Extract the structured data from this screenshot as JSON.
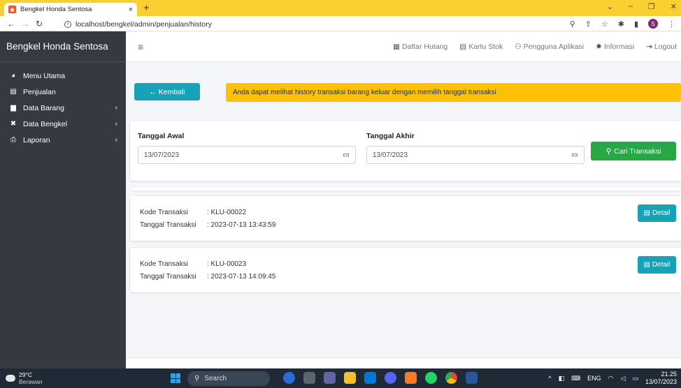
{
  "browser": {
    "tab_title": "Bengkel Honda Sentosa",
    "tab_close": "×",
    "new_tab": "+",
    "url": "localhost/bengkel/admin/penjualan/history"
  },
  "sidebar": {
    "brand": "Bengkel Honda Sentosa",
    "items": [
      {
        "label": "Menu Utama",
        "icon": "tachometer-icon",
        "has_children": false
      },
      {
        "label": "Penjualan",
        "icon": "file-icon",
        "has_children": false
      },
      {
        "label": "Data Barang",
        "icon": "box-icon",
        "has_children": true
      },
      {
        "label": "Data Bengkel",
        "icon": "tools-icon",
        "has_children": true
      },
      {
        "label": "Laporan",
        "icon": "print-icon",
        "has_children": true
      }
    ]
  },
  "topnav": {
    "links": [
      {
        "label": "Daftar Hutang",
        "icon": "calendar-icon"
      },
      {
        "label": "Kartu Stok",
        "icon": "file-icon"
      },
      {
        "label": "Pengguna Aplikasi",
        "icon": "users-icon"
      },
      {
        "label": "Informasi",
        "icon": "gear-icon"
      },
      {
        "label": "Logout",
        "icon": "sign-out-icon"
      }
    ]
  },
  "content": {
    "back_label": "← Kembali",
    "alert_text": "Anda dapat melihat history transaksi barang keluar dengan memilih tanggal transaksi",
    "filter": {
      "start_label": "Tanggal Awal",
      "start_value": "13/07/2023",
      "end_label": "Tanggal Akhir",
      "end_value": "13/07/2023",
      "search_label": "Cari Transaksi"
    },
    "transactions": [
      {
        "code_label": "Kode Transaksi",
        "code": ": KLU-00022",
        "date_label": "Tanggal Transaksi",
        "date": ": 2023-07-13 13:43:59",
        "detail_label": "Detail"
      },
      {
        "code_label": "Kode Transaksi",
        "code": ": KLU-00023",
        "date_label": "Tanggal Transaksi",
        "date": ": 2023-07-13 14:09:45",
        "detail_label": "Detail"
      }
    ]
  },
  "taskbar": {
    "temp": "29°C",
    "weather": "Berawan",
    "search": "Search",
    "lang": "ENG",
    "time": "21.25",
    "date": "13/07/2023"
  },
  "colors": {
    "tab_bar": "#f9cf32",
    "sidebar": "#343a40",
    "info_button": "#17a2b8",
    "alert": "#ffc107",
    "success_button": "#28a745"
  }
}
